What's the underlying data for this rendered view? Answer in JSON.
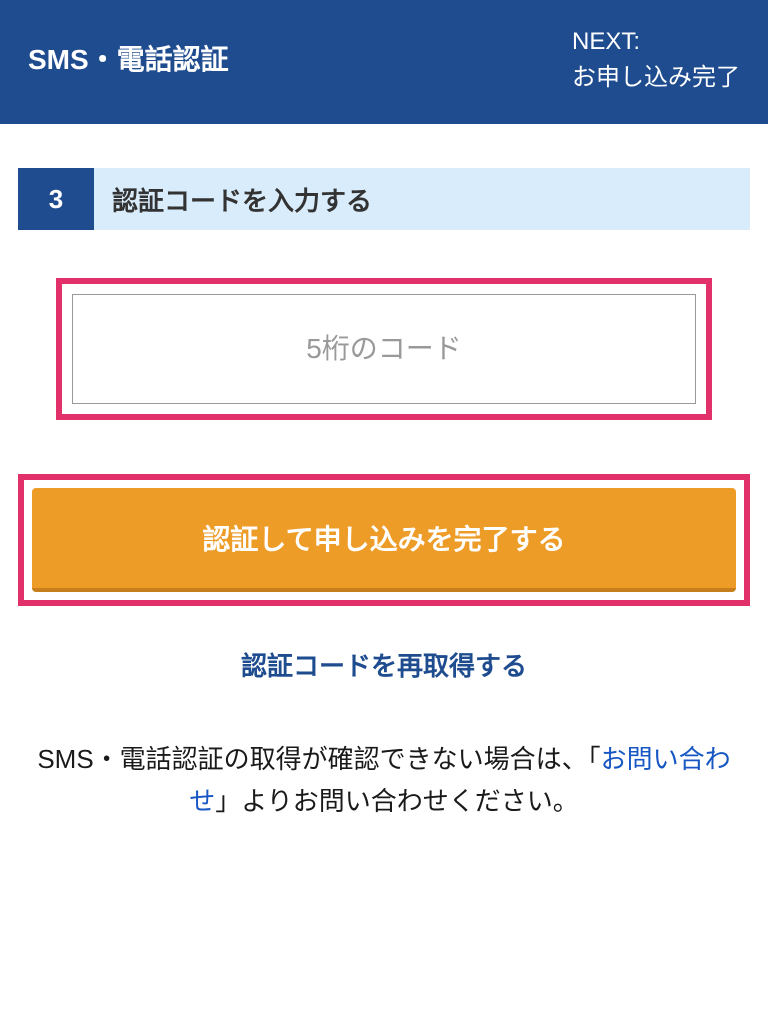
{
  "header": {
    "title": "SMS・電話認証",
    "next_label": "NEXT:",
    "next_step": "お申し込み完了"
  },
  "step": {
    "number": "3",
    "title": "認証コードを入力する"
  },
  "input": {
    "placeholder": "5桁のコード"
  },
  "submit": {
    "label": "認証して申し込みを完了する"
  },
  "resend": {
    "label": "認証コードを再取得する"
  },
  "help": {
    "text_before": "SMS・電話認証の取得が確認できない場合は、「",
    "contact_link": "お問い合わせ",
    "text_after": "」よりお問い合わせください。"
  }
}
